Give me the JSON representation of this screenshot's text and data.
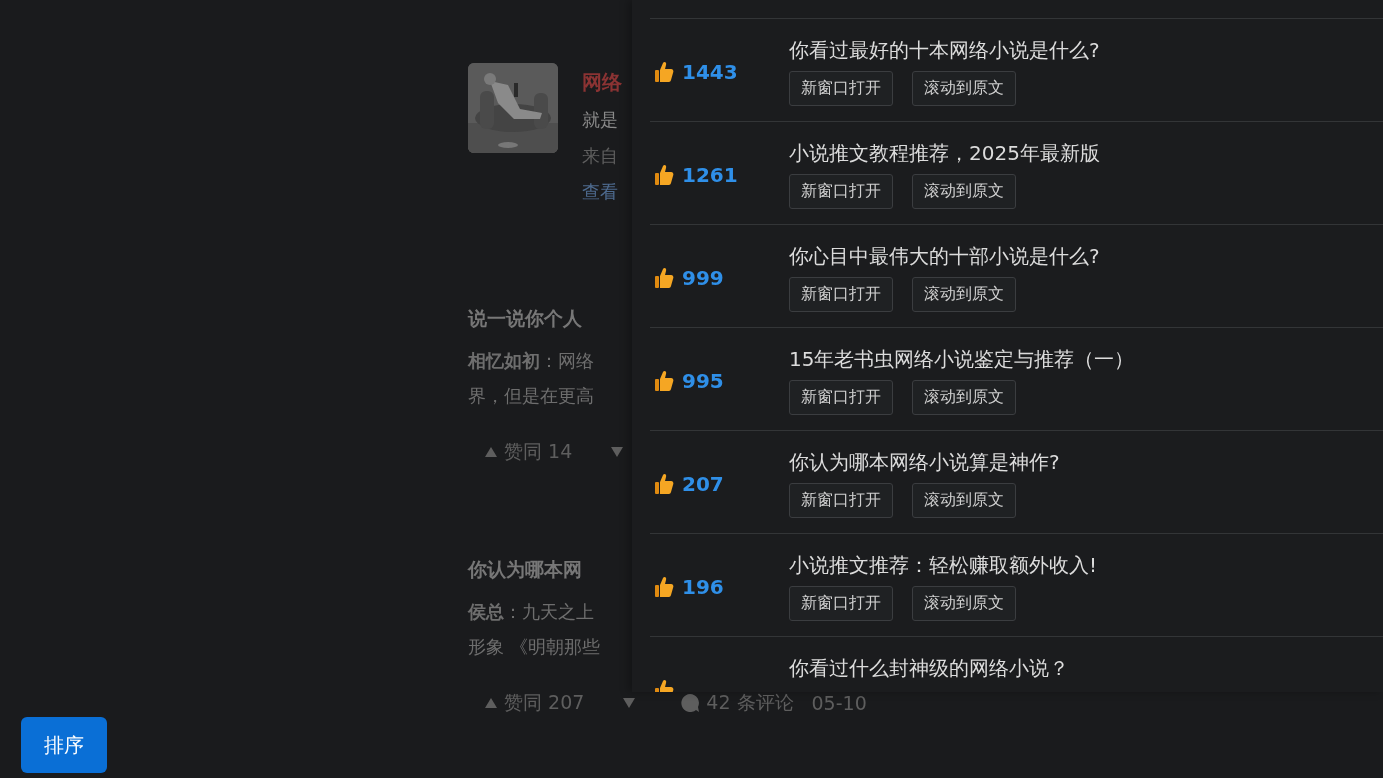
{
  "feed": {
    "profile": {
      "name": "网络",
      "line_1": "就是",
      "line_2": "来自",
      "link": "查看"
    },
    "answers": [
      {
        "question": "说一说你个人",
        "excerpt_1": "**相忆如初**：网络",
        "excerpt_2": "界，但是在更高",
        "upvote": "赞同 14",
        "show_downvote": true
      },
      {
        "question": "你认为哪本网",
        "excerpt_1": "**侯总**：九天之上",
        "excerpt_2": "形象 《明朝那些",
        "upvote": "赞同 207",
        "show_downvote": true,
        "comments": "42 条评论",
        "date": "05-10"
      }
    ]
  },
  "panel": {
    "items": [
      {
        "likes": "1443",
        "title": "你看过最好的十本网络小说是什么?",
        "open_button": "新窗口打开",
        "scroll_button": "滚动到原文"
      },
      {
        "likes": "1261",
        "title": "小说推文教程推荐，2025年最新版",
        "open_button": "新窗口打开",
        "scroll_button": "滚动到原文"
      },
      {
        "likes": "999",
        "title": "你心目中最伟大的十部小说是什么?",
        "open_button": "新窗口打开",
        "scroll_button": "滚动到原文"
      },
      {
        "likes": "995",
        "title": "15年老书虫网络小说鉴定与推荐（一）",
        "open_button": "新窗口打开",
        "scroll_button": "滚动到原文"
      },
      {
        "likes": "207",
        "title": "你认为哪本网络小说算是神作?",
        "open_button": "新窗口打开",
        "scroll_button": "滚动到原文"
      },
      {
        "likes": "196",
        "title": "小说推文推荐：轻松赚取额外收入!",
        "open_button": "新窗口打开",
        "scroll_button": "滚动到原文"
      },
      {
        "title": "你看过什么封神级的网络小说？"
      }
    ]
  },
  "sort_button": "排序"
}
